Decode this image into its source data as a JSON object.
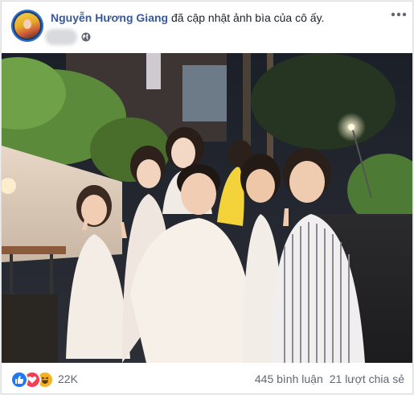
{
  "post": {
    "author": "Nguyễn Hương Giang",
    "action_text": " đã cập nhật ảnh bìa của cô ấy.",
    "audience_icon": "globe-icon",
    "more_icon": "more-horizontal-icon"
  },
  "reactions": {
    "icons": [
      "like-icon",
      "love-icon",
      "haha-icon"
    ],
    "count": "22K"
  },
  "stats": {
    "comments": "445 bình luận",
    "shares": "21 lượt chia sẻ"
  },
  "colors": {
    "author": "#385898",
    "like": "#2078f4",
    "love": "#f33e58",
    "haha": "#f7b125",
    "meta_text": "#606770"
  }
}
